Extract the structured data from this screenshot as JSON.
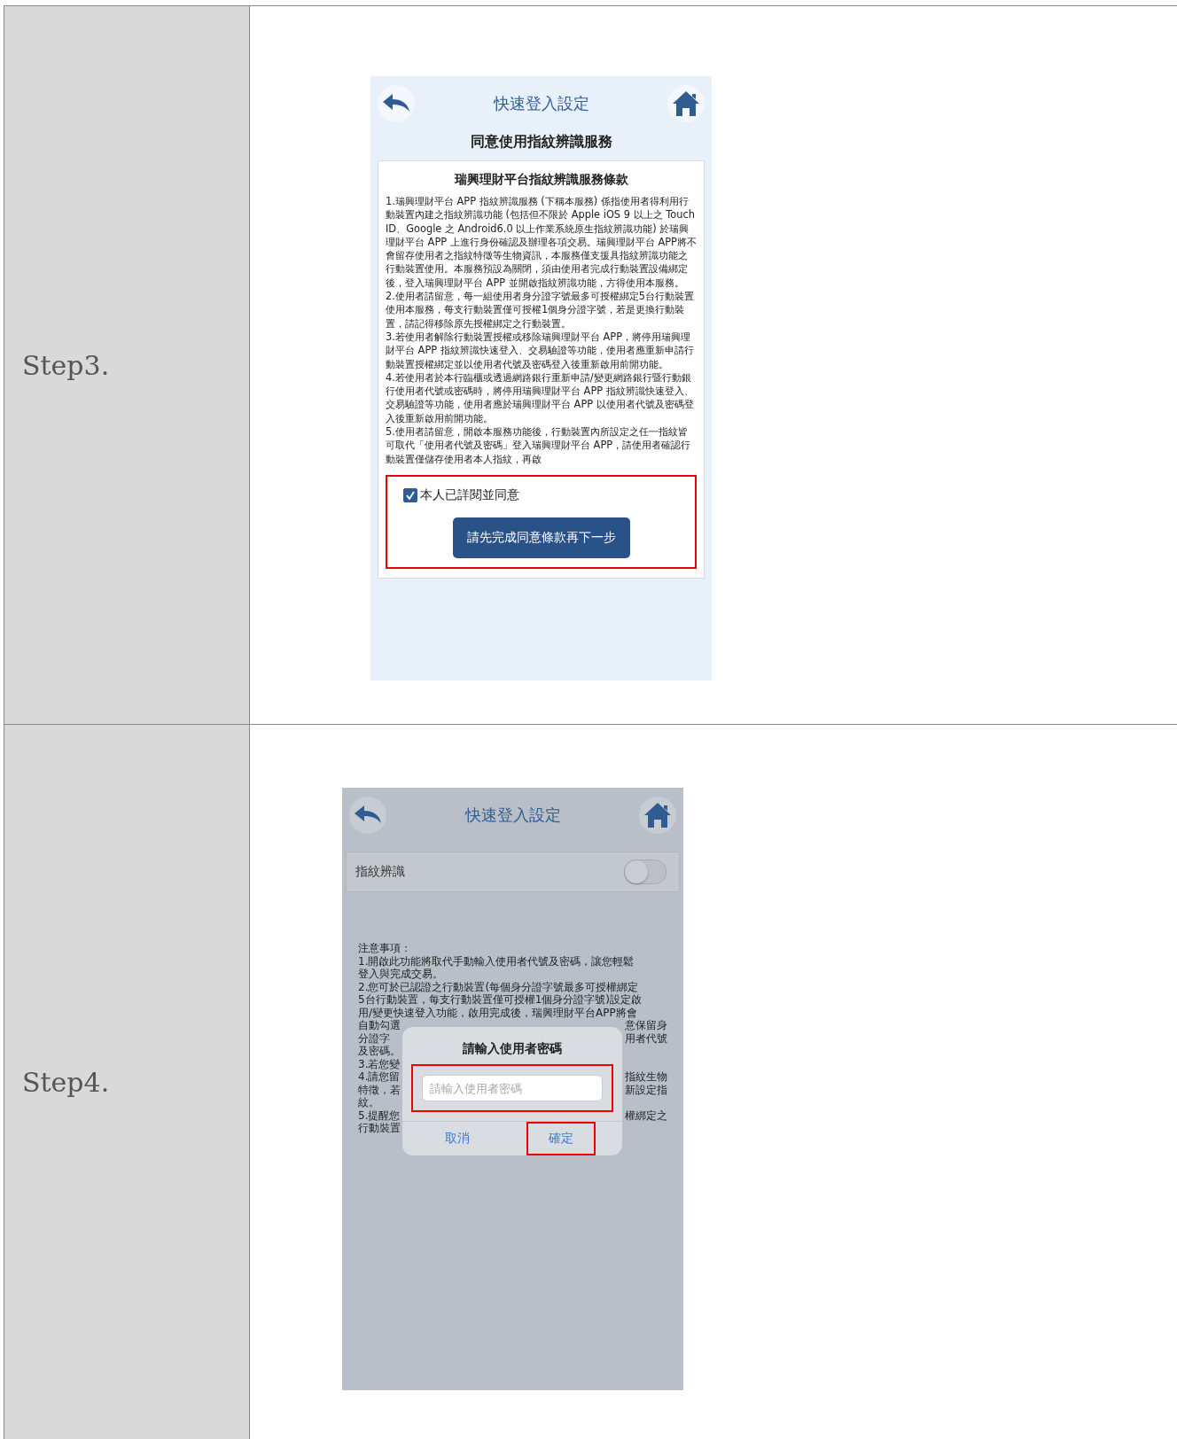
{
  "rows": [
    {
      "step": "Step3.",
      "screen": {
        "kind": "terms",
        "header": {
          "title": "快速登入設定"
        },
        "subtitle": "同意使用指紋辨識服務",
        "terms_title": "瑞興理財平台指紋辨識服務條款",
        "terms": [
          "1.瑞興理財平台 APP 指紋辨識服務 (下稱本服務) 係指使用者得利用行動裝置內建之指紋辨識功能 (包括但不限於 Apple iOS 9 以上之 Touch ID、Google 之 Android6.0 以上作業系統原生指紋辨識功能) 於瑞興理財平台 APP 上進行身份確認及辦理各項交易。瑞興理財平台 APP將不會留存使用者之指紋特徵等生物資訊，本服務僅支援具指紋辨識功能之行動裝置使用。本服務預設為關閉，須由使用者完成行動裝置設備綁定後，登入瑞興理財平台 APP 並開啟指紋辨識功能，方得使用本服務。",
          "2.使用者請留意，每一組使用者身分證字號最多可授權綁定5台行動裝置使用本服務，每支行動裝置僅可授權1個身分證字號，若是更換行動裝置，請記得移除原先授權綁定之行動裝置。",
          "3.若使用者解除行動裝置授權或移除瑞興理財平台 APP，將停用瑞興理財平台 APP 指紋辨識快速登入、交易驗證等功能，使用者應重新申請行動裝置授權綁定並以使用者代號及密碼登入後重新啟用前開功能。",
          "4.若使用者於本行臨櫃或透過網路銀行重新申請/變更網路銀行暨行動銀行使用者代號或密碼時，將停用瑞興理財平台 APP 指紋辨識快速登入、交易驗證等功能，使用者應於瑞興理財平台 APP 以使用者代號及密碼登入後重新啟用前開功能。",
          "5.使用者請留意，開啟本服務功能後，行動裝置內所設定之任一指紋皆可取代「使用者代號及密碼」登入瑞興理財平台 APP，請使用者確認行動裝置僅儲存使用者本人指紋，再啟"
        ],
        "agree": {
          "label": "本人已詳閱並同意",
          "checked": true
        },
        "next_button": "請先完成同意條款再下一步"
      }
    },
    {
      "step": "Step4.",
      "screen": {
        "kind": "settings",
        "header": {
          "title": "快速登入設定"
        },
        "toggle": {
          "label": "指紋辨識",
          "on": false
        },
        "notes": [
          {
            "left": "注意事項："
          },
          {
            "left": "1.開啟此功能將取代手動輸入使用者代號及密碼，讓您輕鬆"
          },
          {
            "left": "登入與完成交易。"
          },
          {
            "left": "2.您可於已認證之行動裝置(每個身分證字號最多可授權綁定"
          },
          {
            "left": "5台行動裝置，每支行動裝置僅可授權1個身分證字號)設定啟"
          },
          {
            "left": "用/變更快速登入功能，啟用完成後，瑞興理財平台APP將會"
          },
          {
            "left": "自動勾選",
            "right": "意保留身"
          },
          {
            "left": "分證字",
            "right": "用者代號"
          },
          {
            "left": "及密碼。"
          },
          {
            "left": "3.若您變"
          },
          {
            "left": "4.請您留",
            "right": "指紋生物"
          },
          {
            "left": "特徵，若",
            "right": "新設定指"
          },
          {
            "left": "紋。"
          },
          {
            "left": "5.提醒您",
            "right": "權綁定之"
          },
          {
            "left": "行動裝置"
          }
        ],
        "dialog": {
          "title": "請輸入使用者密碼",
          "placeholder": "請輸入使用者密碼",
          "buttons": [
            "取消",
            "確定"
          ]
        }
      }
    }
  ]
}
